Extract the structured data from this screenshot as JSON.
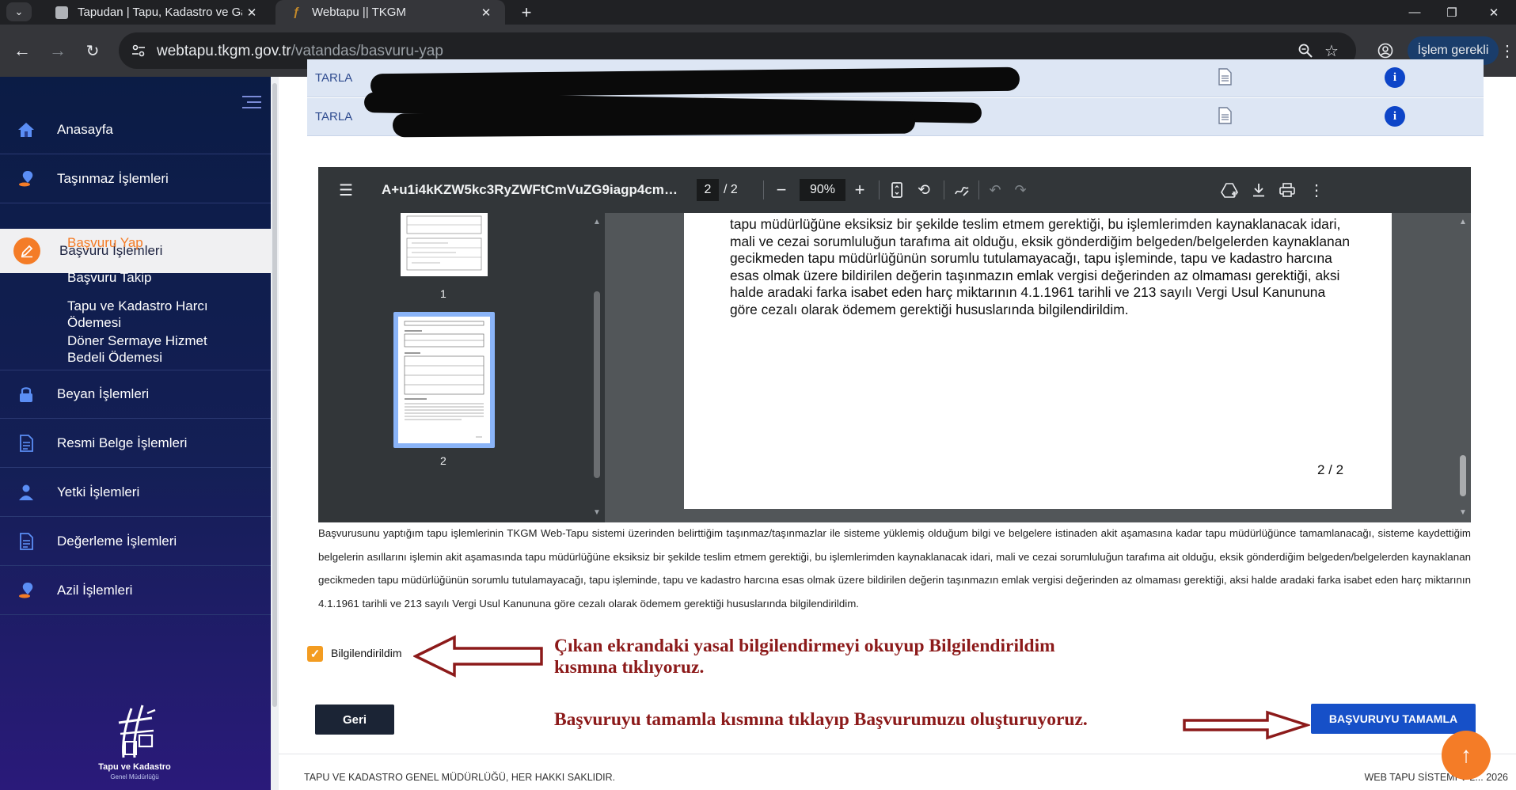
{
  "browser": {
    "tabs": [
      {
        "title": "Tapudan | Tapu, Kadastro ve Ga",
        "close": "✕"
      },
      {
        "title": "Webtapu || TKGM",
        "close": "✕",
        "favicon_glyph": "ƒ"
      }
    ],
    "new_tab": "+",
    "url_host": "webtapu.tkgm.gov.tr",
    "url_path": "/vatandas/basvuru-yap",
    "action_pill": "İşlem gerekli",
    "window_controls": [
      "—",
      "❐",
      "✕"
    ]
  },
  "sidebar": {
    "items": [
      {
        "label": "Anasayfa",
        "icon": "home-icon"
      },
      {
        "label": "Taşınmaz İşlemleri",
        "icon": "map-pin-icon"
      },
      {
        "label": "Beyan İşlemleri",
        "icon": "lock-icon"
      },
      {
        "label": "Resmi Belge İşlemleri",
        "icon": "document-icon"
      },
      {
        "label": "Yetki İşlemleri",
        "icon": "user-icon"
      },
      {
        "label": "Değerleme İşlemleri",
        "icon": "document-icon"
      },
      {
        "label": "Azil İşlemleri",
        "icon": "map-pin-icon"
      }
    ],
    "active": {
      "label": "Başvuru İşlemleri",
      "icon": "pen-icon"
    },
    "subitems": [
      {
        "label": "Başvuru Yap",
        "active": true
      },
      {
        "label": "Başvuru Takip",
        "active": false
      },
      {
        "label": "Tapu ve Kadastro Harcı Ödemesi",
        "active": false
      },
      {
        "label": "Döner Sermaye Hizmet Bedeli Ödemesi",
        "active": false
      }
    ],
    "logo": {
      "line1": "Tapu ve Kadastro",
      "line2": "Genel Müdürlüğü"
    }
  },
  "table": {
    "rows": [
      {
        "type": "TARLA"
      },
      {
        "type": "TARLA"
      }
    ]
  },
  "pdf": {
    "filename": "A+u1i4kKZW5kc3RyZWFtCmVuZG9iagp4cmV...",
    "current_page": "2",
    "page_total": "/ 2",
    "zoom": "90%",
    "thumb_labels": [
      "1",
      "2"
    ],
    "page_text": "tapu müdürlüğüne eksiksiz bir şekilde teslim etmem gerektiği, bu işlemlerimden kaynaklanacak idari, mali ve cezai sorumluluğun tarafıma ait olduğu, eksik gönderdiğim belgeden/belgelerden kaynaklanan gecikmeden tapu müdürlüğünün sorumlu tutulamayacağı, tapu işleminde, tapu ve kadastro harcına esas olmak üzere bildirilen değerin taşınmazın emlak vergisi değerinden az olmaması gerektiği, aksi halde aradaki farka isabet eden harç miktarının 4.1.1961 tarihli ve 213 sayılı Vergi Usul Kanununa göre cezalı olarak ödemem gerektiği hususlarında bilgilendirildim.",
    "page_footer": "2 / 2"
  },
  "disclaimer": "Başvurusunu yaptığım tapu işlemlerinin TKGM Web-Tapu sistemi üzerinden belirttiğim taşınmaz/taşınmazlar ile sisteme yüklemiş olduğum bilgi ve belgelere istinaden akit aşamasına kadar tapu müdürlüğünce tamamlanacağı, sisteme kaydettiğim belgelerin asıllarını işlemin akit aşamasında tapu müdürlüğüne eksiksiz bir şekilde teslim etmem gerektiği, bu işlemlerimden kaynaklanacak idari, mali ve cezai sorumluluğun tarafıma ait olduğu, eksik gönderdiğim belgeden/belgelerden kaynaklanan gecikmeden tapu müdürlüğünün sorumlu tutulamayacağı, tapu işleminde, tapu ve kadastro harcına esas olmak üzere bildirilen değerin taşınmazın emlak vergisi değerinden az olmaması gerektiği, aksi halde aradaki farka isabet eden harç miktarının 4.1.1961 tarihli ve 213 sayılı Vergi Usul Kanununa göre cezalı olarak ödemem gerektiği hususlarında bilgilendirildim.",
  "checkbox": {
    "label": "Bilgilendirildim",
    "checked": true
  },
  "annotations": {
    "line1": "Çıkan ekrandaki yasal bilgilendirmeyi okuyup Bilgilendirildim",
    "line2": "kısmına tıklıyoruz.",
    "line3": "Başvuruyu tamamla kısmına tıklayıp Başvurumuzu oluşturuyoruz.",
    "color": "#8c1a1a"
  },
  "buttons": {
    "back": "Geri",
    "complete": "BAŞVURUYU TAMAMLA",
    "scroll_top": "↑"
  },
  "footer": {
    "left": "TAPU VE KADASTRO GENEL MÜDÜRLÜĞÜ, HER HAKKI SAKLIDIR.",
    "right": "WEB TAPU SİSTEMİ V 2... 2026"
  },
  "colors": {
    "accent_orange": "#f47c27",
    "primary_blue": "#1650c8",
    "sidebar_dark": "#0b1c45"
  }
}
